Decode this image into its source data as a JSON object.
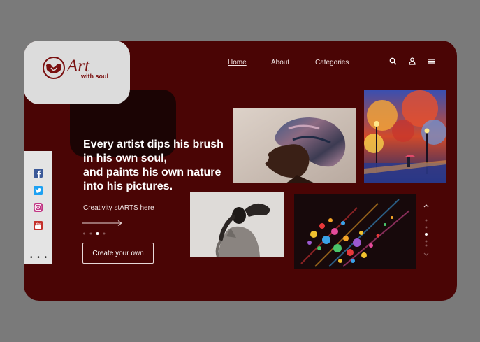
{
  "brand": {
    "name": "Art",
    "tagline": "with soul"
  },
  "nav": {
    "items": [
      {
        "label": "Home",
        "active": true
      },
      {
        "label": "About",
        "active": false
      },
      {
        "label": "Categories",
        "active": false
      }
    ],
    "icons": [
      "search-icon",
      "user-icon",
      "menu-icon"
    ]
  },
  "social": {
    "items": [
      "facebook-icon",
      "twitter-icon",
      "instagram-icon",
      "youtube-icon"
    ],
    "more": "• • •"
  },
  "hero": {
    "headline": "Every artist dips his brush\nin his own soul,\nand paints his own nature\ninto his pictures.",
    "tagline": "Creativity stARTS here",
    "cta": "Create your own",
    "slider": {
      "total": 4,
      "active": 3
    }
  },
  "gallery": {
    "scroll": {
      "total": 5,
      "active": 3
    }
  },
  "colors": {
    "background": "#7a7a7a",
    "panel": "#4a0505",
    "logo_box": "#dcdcdc",
    "accent": "#7a1010",
    "text": "#ffffff"
  }
}
